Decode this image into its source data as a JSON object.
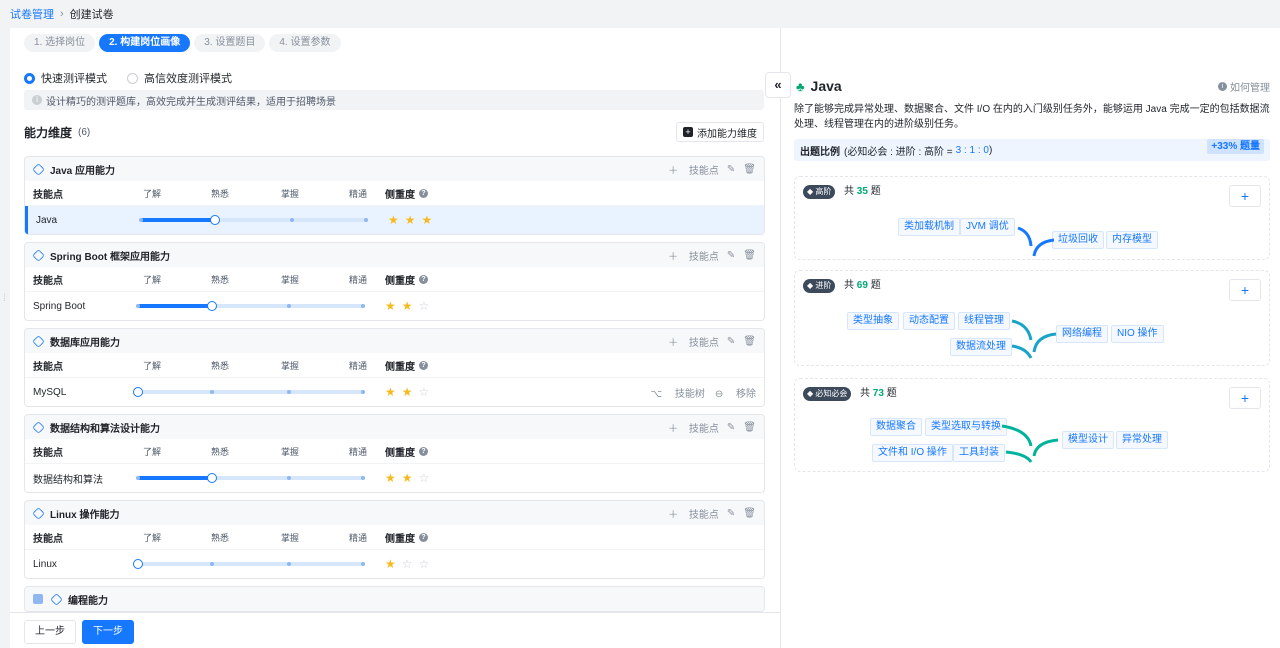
{
  "breadcrumb": {
    "parent": "试卷管理",
    "current": "创建试卷"
  },
  "steps": [
    {
      "label": "1. 选择岗位",
      "active": false
    },
    {
      "label": "2. 构建岗位画像",
      "active": true
    },
    {
      "label": "3. 设置题目",
      "active": false
    },
    {
      "label": "4. 设置参数",
      "active": false
    }
  ],
  "modes": [
    {
      "label": "快速测评模式",
      "selected": true
    },
    {
      "label": "高信效度测评模式",
      "selected": false
    }
  ],
  "tip": "设计精巧的测评题库，高效完成并生成测评结果，适用于招聘场景",
  "dimensions": {
    "title": "能力维度",
    "count": "(6)",
    "add_label": "添加能力维度",
    "col_skill": "技能点",
    "col_importance": "侧重度",
    "levels": [
      "了解",
      "熟悉",
      "掌握",
      "精通"
    ],
    "action_add_skill": "技能点",
    "cards": [
      {
        "title": "Java 应用能力",
        "skill": "Java",
        "level": 1,
        "stars": 3,
        "selected": true
      },
      {
        "title": "Spring Boot 框架应用能力",
        "skill": "Spring Boot",
        "level": 1,
        "stars": 2,
        "selected": false
      },
      {
        "title": "数据库应用能力",
        "skill": "MySQL",
        "level": 0,
        "stars": 2,
        "selected": false,
        "row_actions": [
          "技能树",
          "移除"
        ]
      },
      {
        "title": "数据结构和算法设计能力",
        "skill": "数据结构和算法",
        "level": 1,
        "stars": 2,
        "selected": false
      },
      {
        "title": "Linux 操作能力",
        "skill": "Linux",
        "level": 0,
        "stars": 1,
        "selected": false
      },
      {
        "title": "编程能力"
      }
    ]
  },
  "footer": {
    "prev": "上一步",
    "next": "下一步"
  },
  "right": {
    "collapse": "«",
    "title": "Java",
    "help": "如何管理",
    "desc": "除了能够完成异常处理、数据聚合、文件 I/O 在内的入门级别任务外，能够运用 Java 完成一定的包括数据流处理、线程管理在内的进阶级别任务。",
    "ratio_label": "出题比例",
    "ratio_text": "(必知必会 : 进阶 : 高阶 =",
    "ratio_nums": "3 : 1 : 0",
    "ratio_close": ")",
    "ratio_badge": "+33% 题量",
    "levels": [
      {
        "tag": "高阶",
        "count_prefix": "共",
        "count": "35",
        "count_suffix": "题",
        "chips": [
          "类加载机制",
          "JVM 调优",
          "垃圾回收",
          "内存模型"
        ]
      },
      {
        "tag": "进阶",
        "count_prefix": "共",
        "count": "69",
        "count_suffix": "题",
        "chips": [
          "类型抽象",
          "动态配置",
          "线程管理",
          "数据流处理",
          "网络编程",
          "NIO 操作"
        ]
      },
      {
        "tag": "必知必会",
        "count_prefix": "共",
        "count": "73",
        "count_suffix": "题",
        "chips": [
          "数据聚合",
          "类型选取与转换",
          "文件和 I/O 操作",
          "工具封装",
          "模型设计",
          "异常处理"
        ]
      }
    ],
    "colors": {
      "advanced": "#1677ff",
      "basic": "#00b39b"
    }
  }
}
